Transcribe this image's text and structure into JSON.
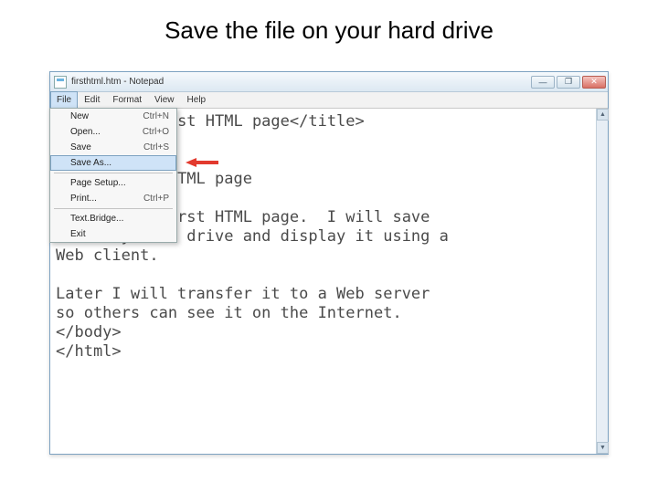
{
  "slide": {
    "title": "Save the file on your hard drive"
  },
  "window": {
    "title": "firsthtml.htm - Notepad",
    "buttons": {
      "min": "—",
      "max": "❐",
      "close": "✕"
    }
  },
  "menubar": [
    "File",
    "Edit",
    "Format",
    "View",
    "Help"
  ],
  "file_menu": {
    "items": [
      {
        "label": "New",
        "shortcut": "Ctrl+N",
        "highlight": false
      },
      {
        "label": "Open...",
        "shortcut": "Ctrl+O",
        "highlight": false
      },
      {
        "label": "Save",
        "shortcut": "Ctrl+S",
        "highlight": false
      },
      {
        "label": "Save As...",
        "shortcut": "",
        "highlight": true
      },
      {
        "sep": true
      },
      {
        "label": "Page Setup...",
        "shortcut": "",
        "highlight": false
      },
      {
        "label": "Print...",
        "shortcut": "Ctrl+P",
        "highlight": false
      },
      {
        "sep": true
      },
      {
        "label": "Text.Bridge...",
        "shortcut": "",
        "highlight": false
      },
      {
        "label": "Exit",
        "shortcut": "",
        "highlight": false
      }
    ]
  },
  "editor": {
    "lines": [
      "st HTML page</title>",
      "",
      "",
      "TML page",
      "",
      "This is my first HTML page.  I will save",
      "it on my hard drive and display it using a",
      "Web client.",
      "",
      "Later I will transfer it to a Web server",
      "so others can see it on the Internet.",
      "</body>",
      "</html>"
    ]
  }
}
